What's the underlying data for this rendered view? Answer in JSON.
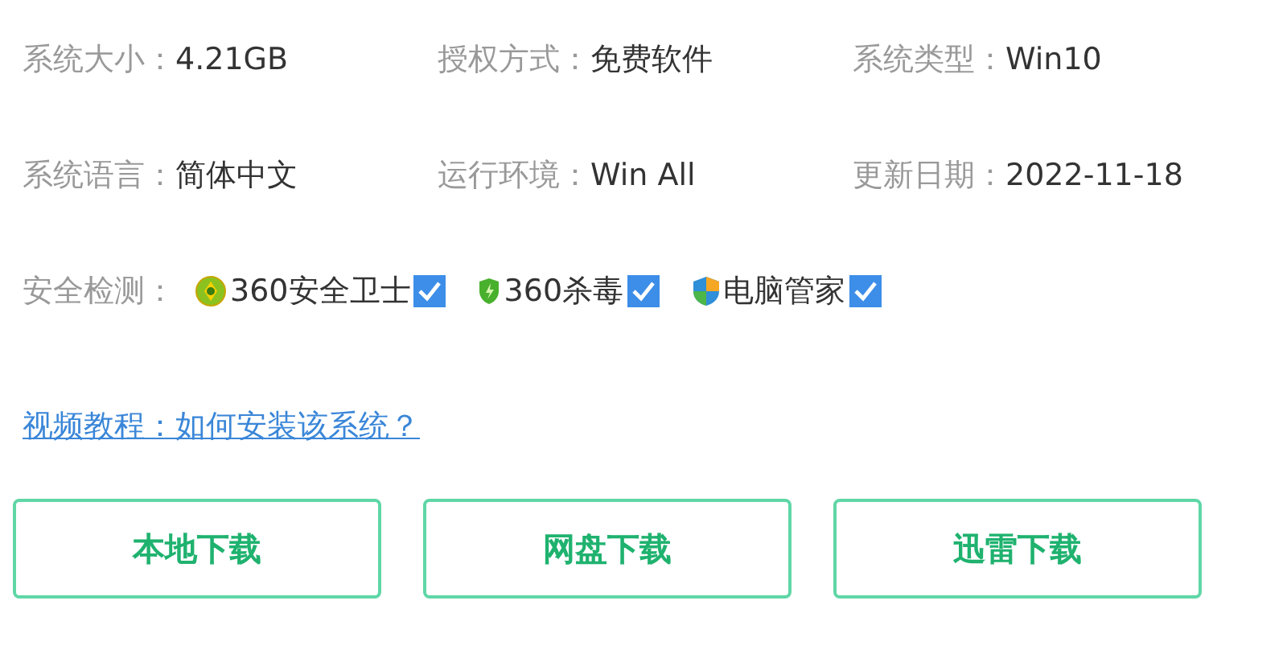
{
  "info": [
    {
      "label": "系统大小：",
      "value": "4.21GB"
    },
    {
      "label": "授权方式：",
      "value": "免费软件"
    },
    {
      "label": "系统类型：",
      "value": "Win10"
    },
    {
      "label": "系统语言：",
      "value": "简体中文"
    },
    {
      "label": "运行环境：",
      "value": "Win All"
    },
    {
      "label": "更新日期：",
      "value": "2022-11-18"
    }
  ],
  "security": {
    "label": "安全检测：",
    "checks": [
      {
        "name": "360安全卫士",
        "checked": true
      },
      {
        "name": "360杀毒",
        "checked": true
      },
      {
        "name": "电脑管家",
        "checked": true
      }
    ]
  },
  "tutorial_link": "视频教程：如何安装该系统？",
  "buttons": [
    "本地下载",
    "网盘下载",
    "迅雷下载"
  ]
}
